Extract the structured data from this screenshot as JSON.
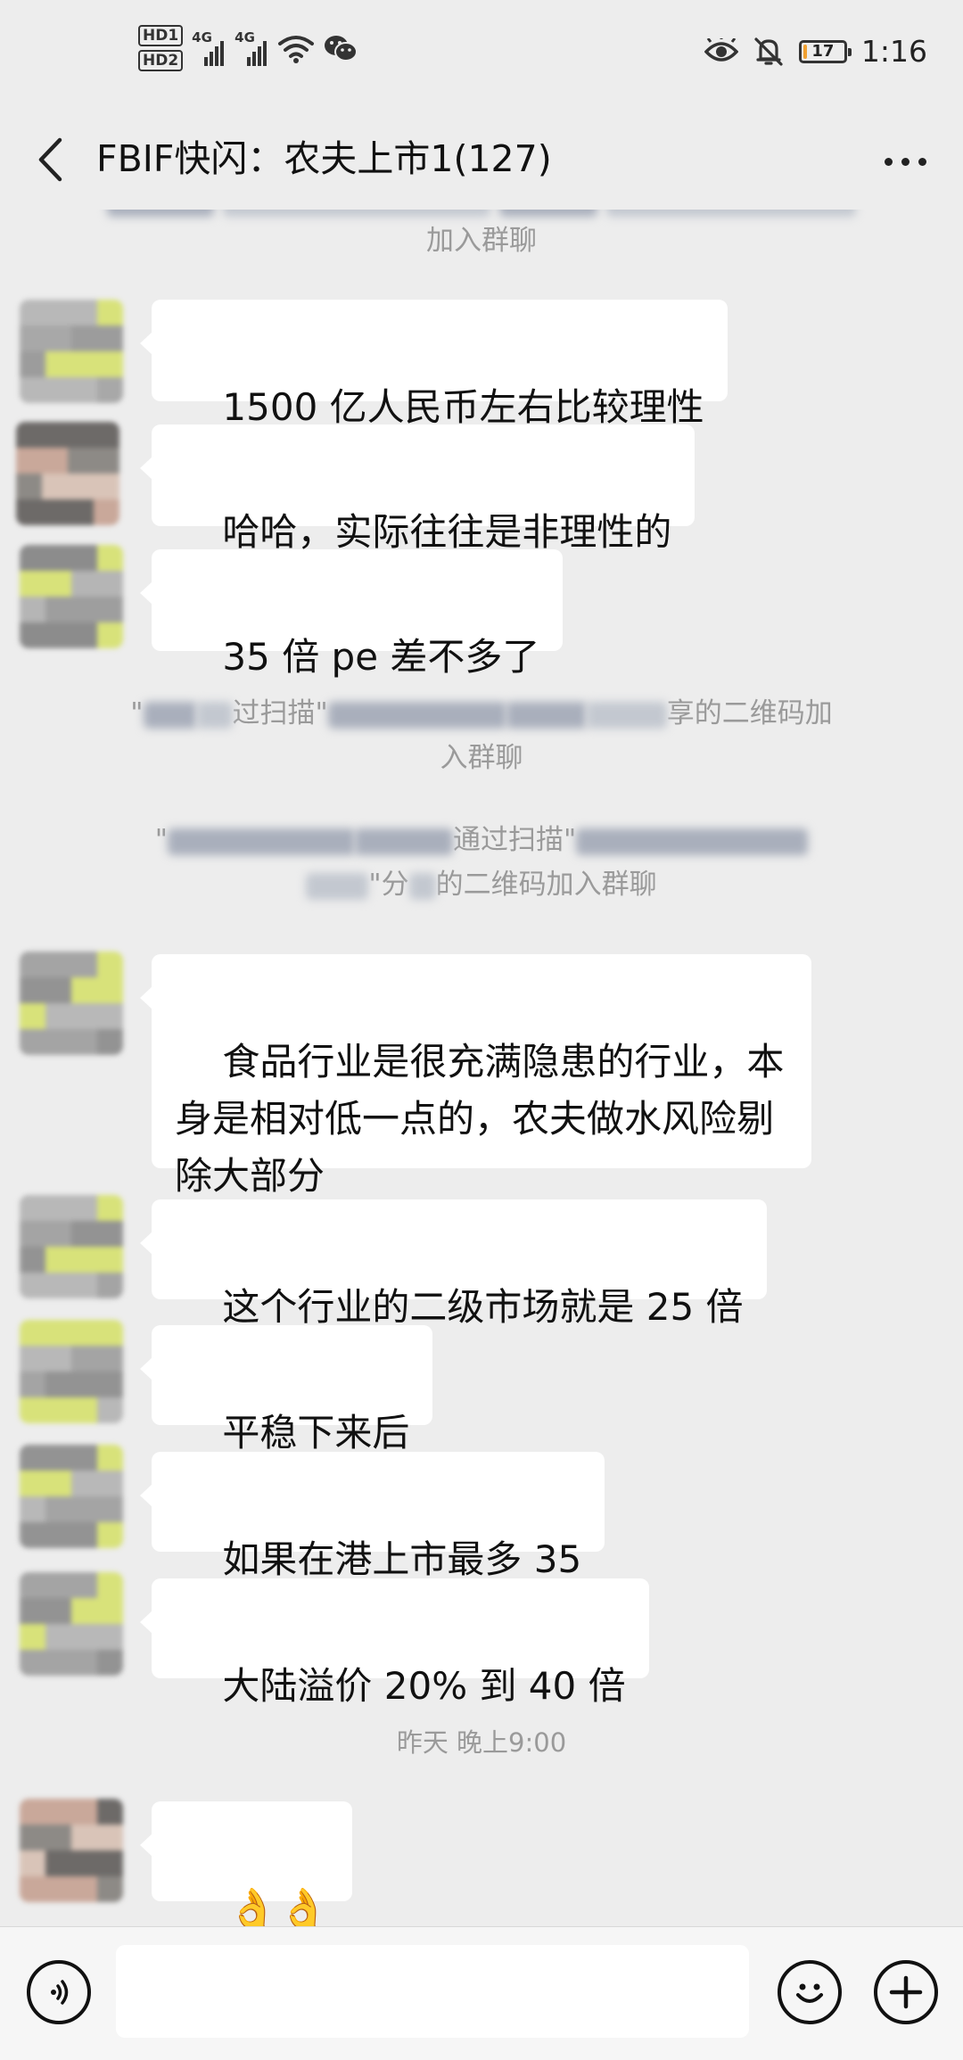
{
  "status_bar": {
    "sim1": "HD1",
    "sim2": "HD2",
    "network1": "4G",
    "network2": "4G",
    "battery": "17",
    "battery_level": 0.17,
    "time": "1:16",
    "icons": [
      "eye-icon",
      "mute-bell-icon",
      "wifi-icon",
      "wechat-icon"
    ]
  },
  "header": {
    "title": "FBIF快闪：农夫上市1(127)",
    "back_icon": "chevron-left-icon",
    "more_icon": "more-dots-icon"
  },
  "messages": [
    {
      "type": "system",
      "text_visible": "加入群聊"
    },
    {
      "type": "text",
      "text": "1500 亿人民币左右比较理性"
    },
    {
      "type": "text",
      "text": "哈哈，实际往往是非理性的"
    },
    {
      "type": "text",
      "text": "35 倍 pe 差不多了"
    },
    {
      "type": "system",
      "parts": [
        "\"",
        "过扫描\"",
        "享的二维码加",
        "入群聊"
      ]
    },
    {
      "type": "system",
      "parts": [
        "\"",
        "通过扫描\"",
        "\"分",
        "的二维码加入群聊"
      ]
    },
    {
      "type": "text",
      "text": "食品行业是很充满隐患的行业，本身是相对低一点的，农夫做水风险剔除大部分"
    },
    {
      "type": "text",
      "text": "这个行业的二级市场就是 25 倍"
    },
    {
      "type": "text",
      "text": "平稳下来后"
    },
    {
      "type": "text",
      "text": "如果在港上市最多 35"
    },
    {
      "type": "text",
      "text": "大陆溢价 20% 到 40 倍"
    },
    {
      "type": "time",
      "text": "昨天 晚上9:00"
    },
    {
      "type": "emoji",
      "text": "👌👌"
    }
  ],
  "input_bar": {
    "voice_icon": "voice-icon",
    "emoji_icon": "smiley-icon",
    "plus_icon": "plus-icon",
    "placeholder": ""
  },
  "colors": {
    "background": "#ededed",
    "bubble": "#ffffff",
    "system_text": "#9a9a9a",
    "battery_fill": "#f0a030"
  }
}
